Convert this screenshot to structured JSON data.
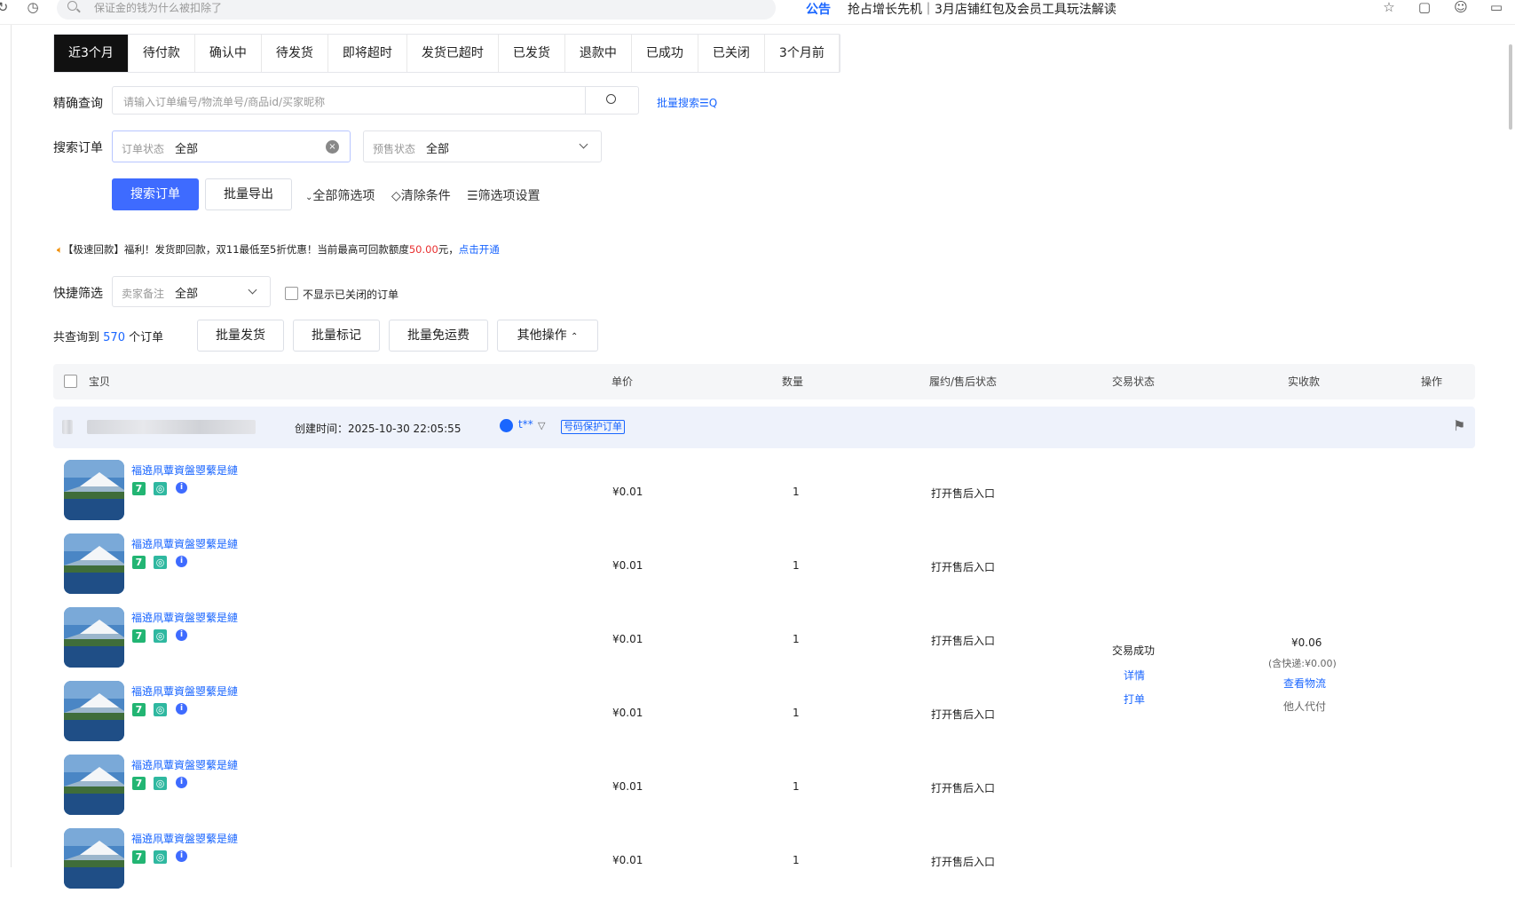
{
  "top": {
    "search_placeholder": "保证金的钱为什么被扣除了",
    "notice_tag": "公告",
    "notice_text": "抢占增长先机｜3月店铺红包及会员工具玩法解读"
  },
  "tabs": [
    "近3个月",
    "待付款",
    "确认中",
    "待发货",
    "即将超时",
    "发货已超时",
    "已发货",
    "退款中",
    "已成功",
    "已关闭",
    "3个月前"
  ],
  "exact_query": {
    "label": "精确查询",
    "placeholder": "请输入订单编号/物流单号/商品id/买家昵称",
    "batch_search": "批量搜索☰Q"
  },
  "search_orders": {
    "label": "搜索订单",
    "status_label": "订单状态",
    "status_value": "全部",
    "presale_label": "预售状态",
    "presale_value": "全部"
  },
  "actions": {
    "search_btn": "搜索订单",
    "export_btn": "批量导出",
    "all_filters": "全部筛选项",
    "clear": "清除条件",
    "filter_settings": "筛选项设置"
  },
  "promo": {
    "prefix": "【极速回款】福利！发货即回款，双11最低至5折优惠！当前最高可回款额度",
    "amount": "50.00",
    "suffix": "元，",
    "link": "点击开通"
  },
  "quick_filter": {
    "label": "快捷筛选",
    "remark_label": "卖家备注",
    "remark_value": "全部",
    "hide_closed": "不显示已关闭的订单"
  },
  "summary": {
    "prefix": "共查询到",
    "count": "570",
    "suffix": "个订单",
    "btn_ship": "批量发货",
    "btn_mark": "批量标记",
    "btn_freeship": "批量免运费",
    "btn_other": "其他操作"
  },
  "table_head": {
    "item": "宝贝",
    "price": "单价",
    "qty": "数量",
    "after_sale": "履约/售后状态",
    "trade_status": "交易状态",
    "received": "实收款",
    "ops": "操作"
  },
  "order": {
    "created": "创建时间：2025-10-30 22:05:55",
    "buyer": "t**",
    "protect_tag": "号码保护订单",
    "trade_status": "交易成功",
    "detail": "详情",
    "print": "打单",
    "amount": "¥0.06",
    "shipping_note": "(含快递:¥0.00)",
    "logistics": "查看物流",
    "proxy_pay": "他人代付",
    "items": [
      {
        "name": "褔遶凧蕈資盤曌蘩是縺",
        "price": "¥0.01",
        "qty": "1",
        "after_sale": "打开售后入口"
      },
      {
        "name": "褔遶凧蕈資盤曌蘩是縺",
        "price": "¥0.01",
        "qty": "1",
        "after_sale": "打开售后入口"
      },
      {
        "name": "褔遶凧蕈資盤曌蘩是縺",
        "price": "¥0.01",
        "qty": "1",
        "after_sale": "打开售后入口"
      },
      {
        "name": "褔遶凧蕈資盤曌蘩是縺",
        "price": "¥0.01",
        "qty": "1",
        "after_sale": "打开售后入口"
      },
      {
        "name": "褔遶凧蕈資盤曌蘩是縺",
        "price": "¥0.01",
        "qty": "1",
        "after_sale": "打开售后入口"
      },
      {
        "name": "褔遶凧蕈資盤曌蘩是縺",
        "price": "¥0.01",
        "qty": "1",
        "after_sale": "打开售后入口"
      }
    ]
  }
}
